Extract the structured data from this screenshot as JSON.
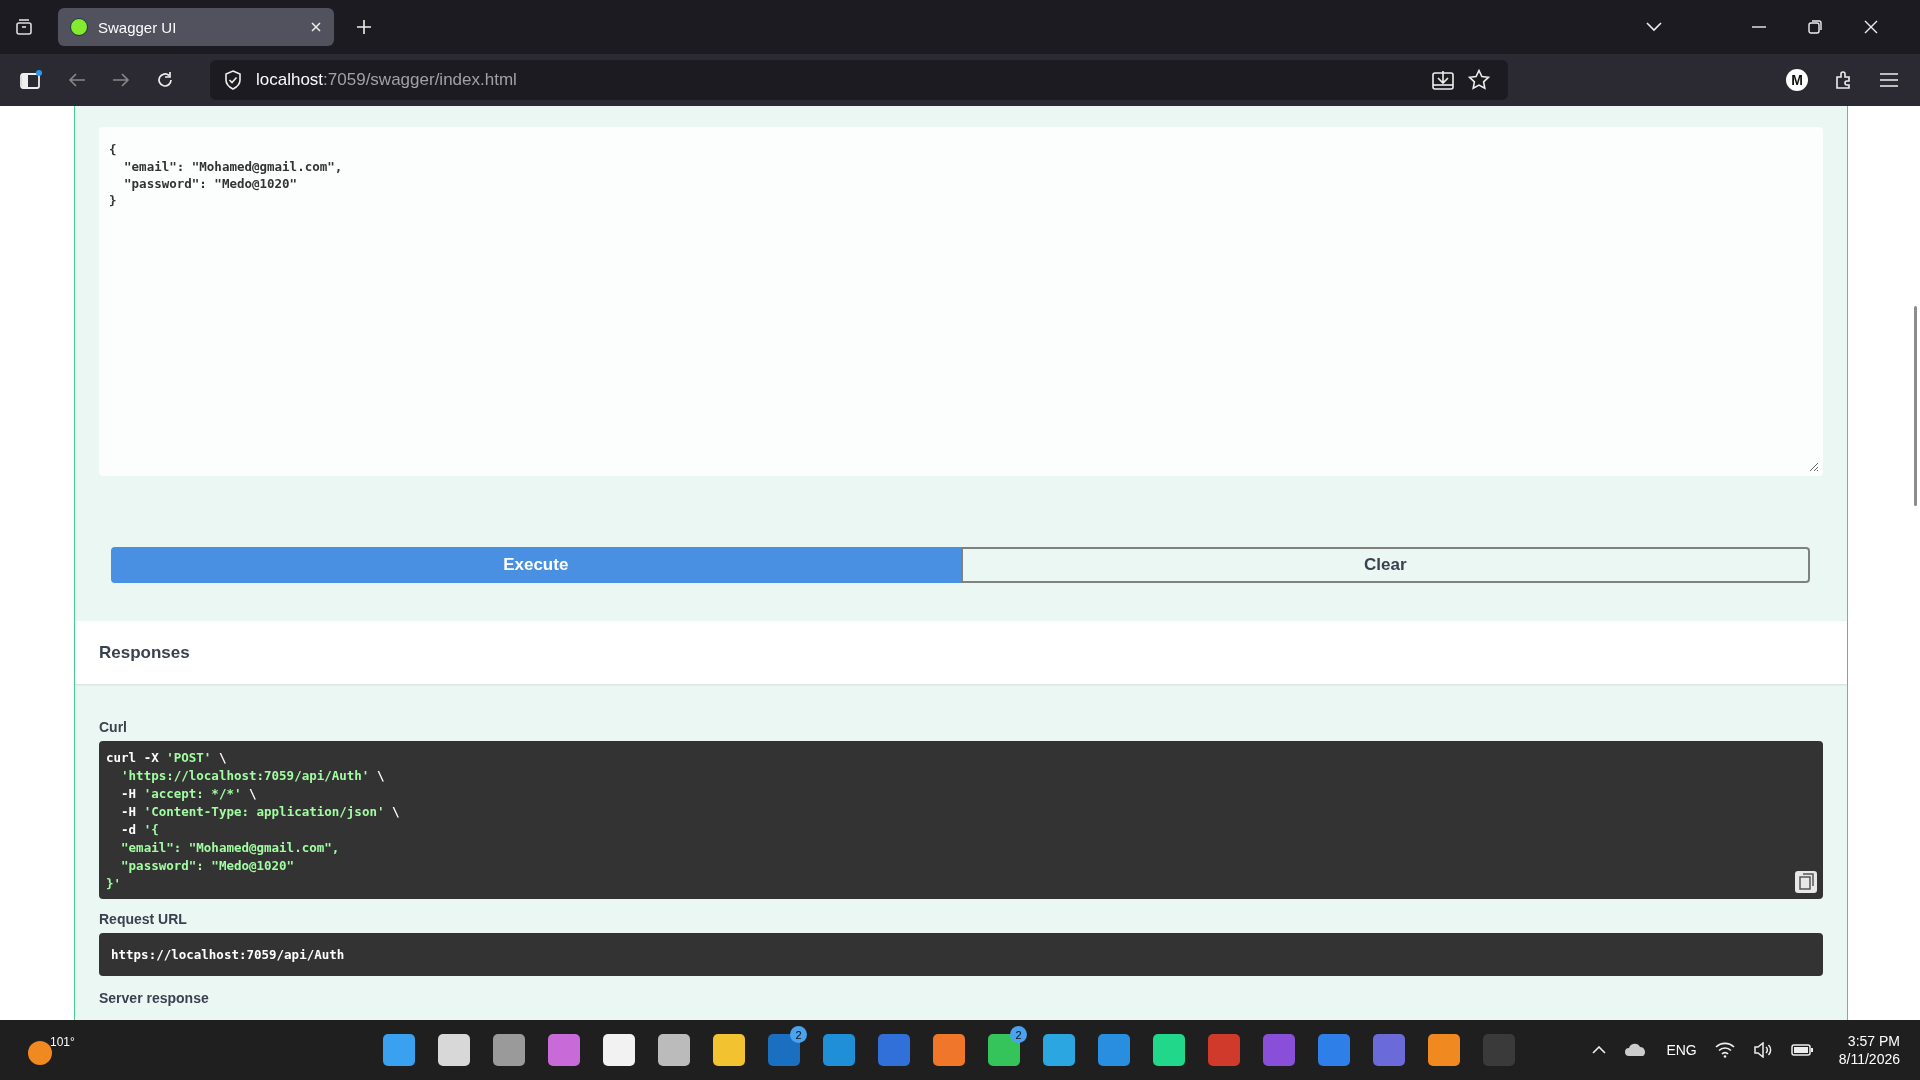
{
  "browser": {
    "tab": {
      "title": "Swagger UI",
      "selected": true
    },
    "address": {
      "host": "localhost",
      "path": ":7059/swagger/index.html"
    },
    "profile_initial": "M"
  },
  "request_body": {
    "lines": [
      "{",
      "  \"email\": \"Mohamed@gmail.com\",",
      "  \"password\": \"Medo@1020\"",
      "}"
    ]
  },
  "buttons": [
    {
      "label": "Execute",
      "kind": "primary"
    },
    {
      "label": "Clear",
      "kind": "secondary"
    }
  ],
  "responses": {
    "heading": "Responses",
    "curl": {
      "label": "Curl",
      "lines": [
        [
          {
            "text": "curl -X ",
            "kind": "plain"
          },
          {
            "text": "'POST'",
            "kind": "string"
          },
          {
            "text": " \\",
            "kind": "plain"
          }
        ],
        [
          {
            "text": "  'https://localhost:7059/api/Auth'",
            "kind": "string"
          },
          {
            "text": " \\",
            "kind": "plain"
          }
        ],
        [
          {
            "text": "  -H ",
            "kind": "plain"
          },
          {
            "text": "'accept: */*'",
            "kind": "string"
          },
          {
            "text": " \\",
            "kind": "plain"
          }
        ],
        [
          {
            "text": "  -H ",
            "kind": "plain"
          },
          {
            "text": "'Content-Type: application/json'",
            "kind": "string"
          },
          {
            "text": " \\",
            "kind": "plain"
          }
        ],
        [
          {
            "text": "  -d ",
            "kind": "plain"
          },
          {
            "text": "'{",
            "kind": "string"
          }
        ],
        [
          {
            "text": "  \"email\": \"Mohamed@gmail.com\",",
            "kind": "string"
          }
        ],
        [
          {
            "text": "  \"password\": \"Medo@1020\"",
            "kind": "string"
          }
        ],
        [
          {
            "text": "}'",
            "kind": "string"
          }
        ]
      ]
    },
    "request_url": {
      "label": "Request URL",
      "value": "https://localhost:7059/api/Auth"
    },
    "server_response": {
      "label": "Server response"
    }
  },
  "taskbar": {
    "weather": "101°",
    "apps": [
      {
        "kind": "start"
      },
      {
        "kind": "search"
      },
      {
        "kind": "taskview"
      },
      {
        "kind": "copilot"
      },
      {
        "kind": "store"
      },
      {
        "kind": "notes"
      },
      {
        "kind": "files"
      },
      {
        "kind": "linkedin",
        "badge": "2"
      },
      {
        "kind": "edge"
      },
      {
        "kind": "photos"
      },
      {
        "kind": "firefox"
      },
      {
        "kind": "whatsapp",
        "badge": "2"
      },
      {
        "kind": "telegram"
      },
      {
        "kind": "vscode"
      },
      {
        "kind": "pycharm"
      },
      {
        "kind": "tiles"
      },
      {
        "kind": "vs"
      },
      {
        "kind": "hourglass"
      },
      {
        "kind": "teams"
      },
      {
        "kind": "diagram"
      },
      {
        "kind": "terminal"
      }
    ],
    "language": "ENG",
    "time": "3:57 PM",
    "date": "8/11/2026"
  }
}
